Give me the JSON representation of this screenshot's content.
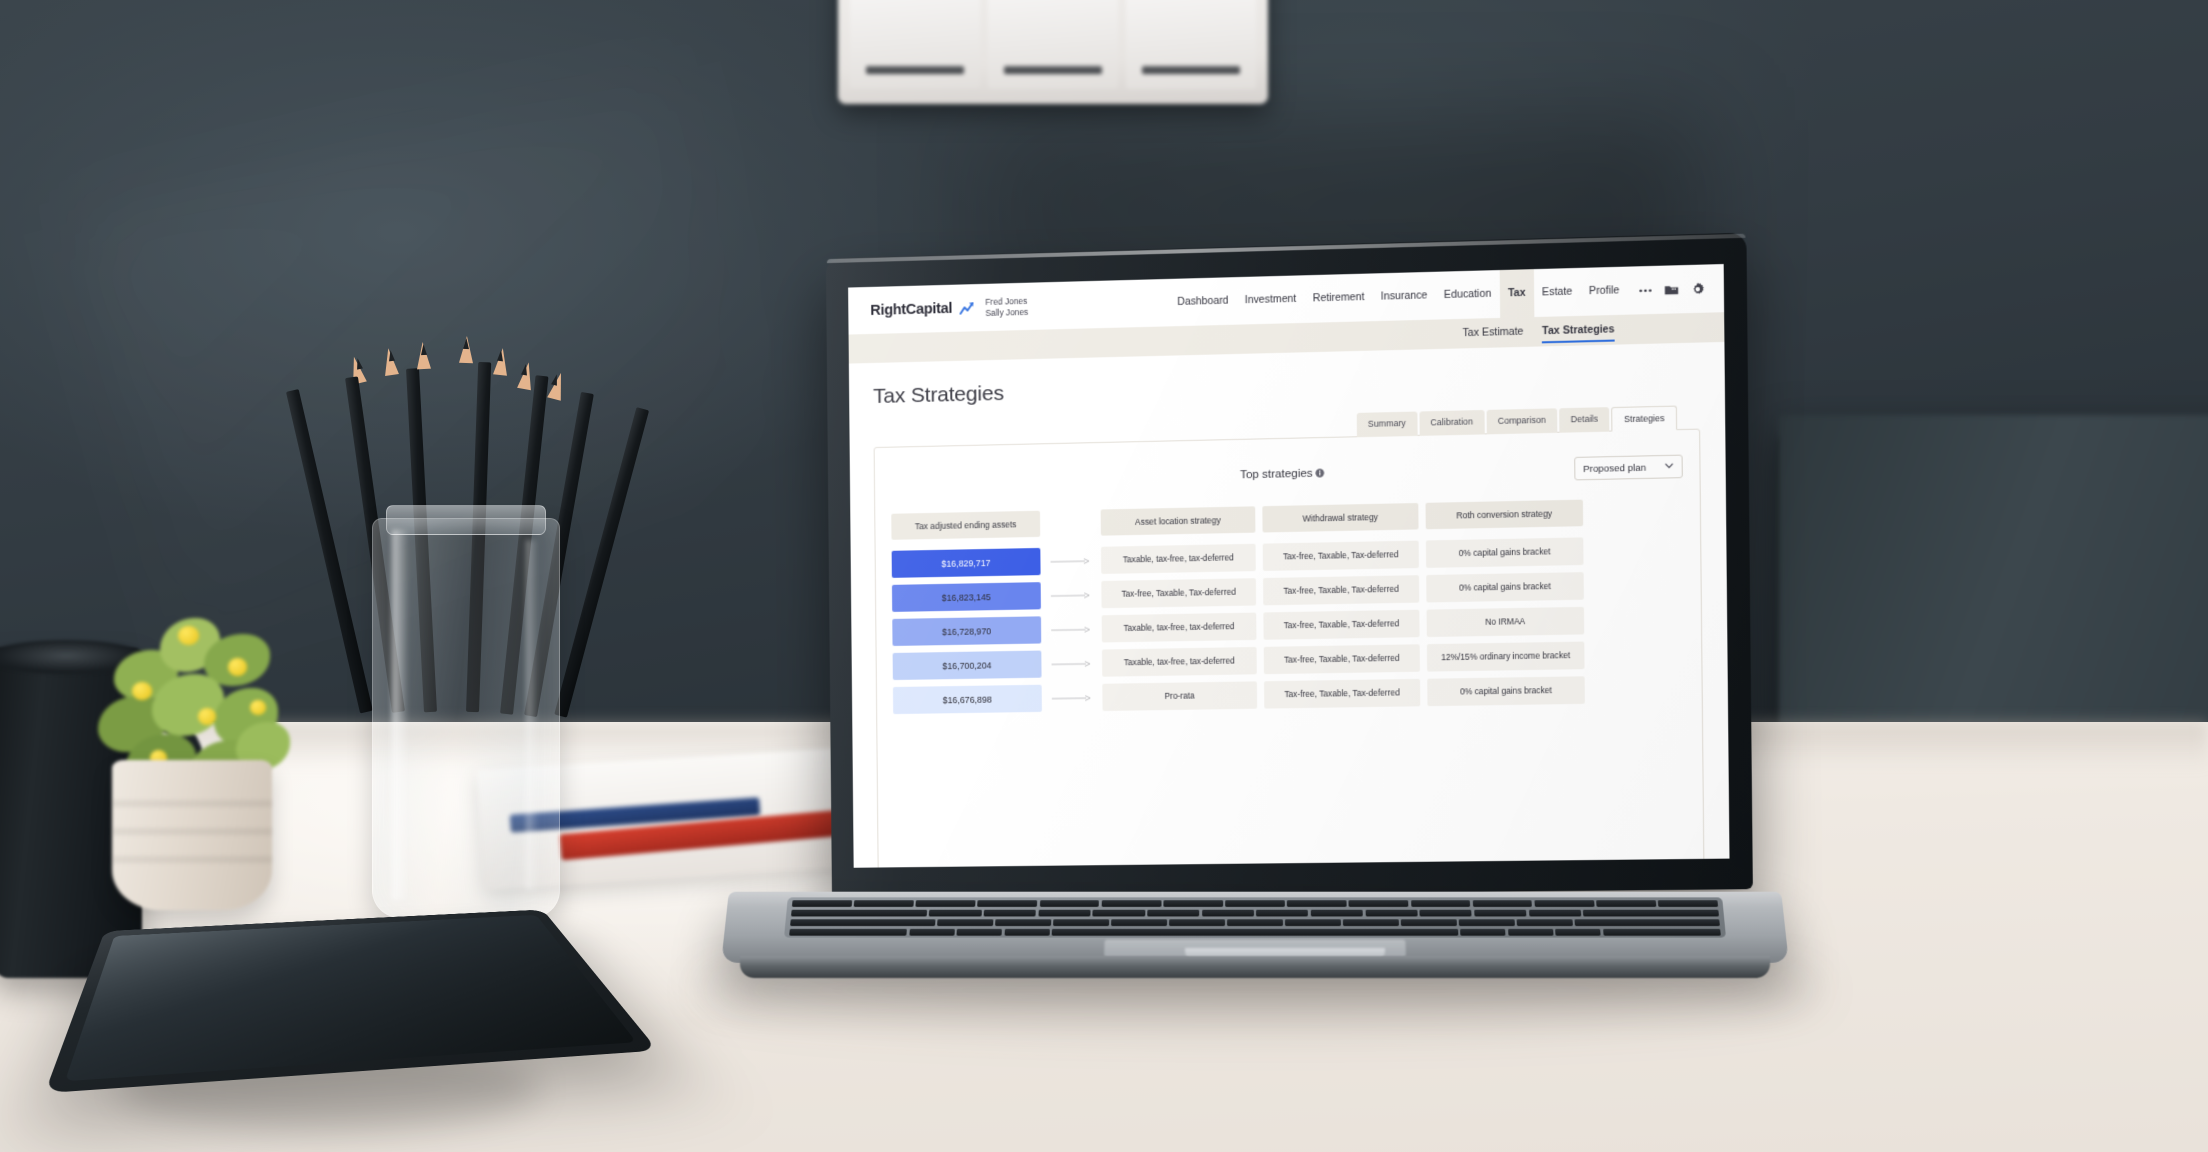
{
  "app": {
    "brand": "RightCapital",
    "brand_icon": "chart-arrow-icon",
    "client_primary": "Fred Jones",
    "client_secondary": "Sally Jones"
  },
  "topnav": {
    "links": [
      {
        "label": "Dashboard",
        "active": false
      },
      {
        "label": "Investment",
        "active": false
      },
      {
        "label": "Retirement",
        "active": false
      },
      {
        "label": "Insurance",
        "active": false
      },
      {
        "label": "Education",
        "active": false
      },
      {
        "label": "Tax",
        "active": true
      },
      {
        "label": "Estate",
        "active": false
      },
      {
        "label": "Profile",
        "active": false
      }
    ],
    "icons": [
      {
        "name": "more-ellipsis-icon"
      },
      {
        "name": "folder-icon"
      },
      {
        "name": "gear-icon"
      }
    ]
  },
  "subnav": {
    "items": [
      {
        "label": "Tax Estimate",
        "active": false
      },
      {
        "label": "Tax Strategies",
        "active": true
      }
    ],
    "accent": "#2f6fe0"
  },
  "page": {
    "title": "Tax Strategies"
  },
  "tabs": [
    {
      "label": "Summary",
      "active": false
    },
    {
      "label": "Calibration",
      "active": false
    },
    {
      "label": "Comparison",
      "active": false
    },
    {
      "label": "Details",
      "active": false
    },
    {
      "label": "Strategies",
      "active": true
    }
  ],
  "panel": {
    "title": "Top strategies",
    "title_info_icon": "info-icon",
    "plan_selector": {
      "value": "Proposed plan",
      "chevron_icon": "chevron-down-icon"
    }
  },
  "chart_data": {
    "type": "table",
    "title": "Top strategies",
    "columns": [
      "Tax adjusted ending assets",
      "Asset location strategy",
      "Withdrawal strategy",
      "Roth conversion strategy"
    ],
    "rows": [
      {
        "value_label": "$16,829,717",
        "value": 16829717,
        "bar_color": "#3d5fe6",
        "asset_location": "Taxable, tax-free, tax-deferred",
        "withdrawal": "Tax-free, Taxable, Tax-deferred",
        "roth_conversion": "0% capital gains bracket"
      },
      {
        "value_label": "$16,823,145",
        "value": 16823145,
        "bar_color": "#6985ee",
        "asset_location": "Tax-free, Taxable, Tax-deferred",
        "withdrawal": "Tax-free, Taxable, Tax-deferred",
        "roth_conversion": "0% capital gains bracket"
      },
      {
        "value_label": "$16,728,970",
        "value": 16728970,
        "bar_color": "#93aaf3",
        "asset_location": "Taxable, tax-free, tax-deferred",
        "withdrawal": "Tax-free, Taxable, Tax-deferred",
        "roth_conversion": "No IRMAA"
      },
      {
        "value_label": "$16,700,204",
        "value": 16700204,
        "bar_color": "#bfd1f9",
        "asset_location": "Taxable, tax-free, tax-deferred",
        "withdrawal": "Tax-free, Taxable, Tax-deferred",
        "roth_conversion": "12%/15% ordinary income bracket"
      },
      {
        "value_label": "$16,676,898",
        "value": 16676898,
        "bar_color": "#dde8fd",
        "asset_location": "Pro-rata",
        "withdrawal": "Tax-free, Taxable, Tax-deferred",
        "roth_conversion": "0% capital gains bracket"
      }
    ],
    "xlabel": "",
    "ylabel": "Tax adjusted ending assets",
    "legend": []
  }
}
